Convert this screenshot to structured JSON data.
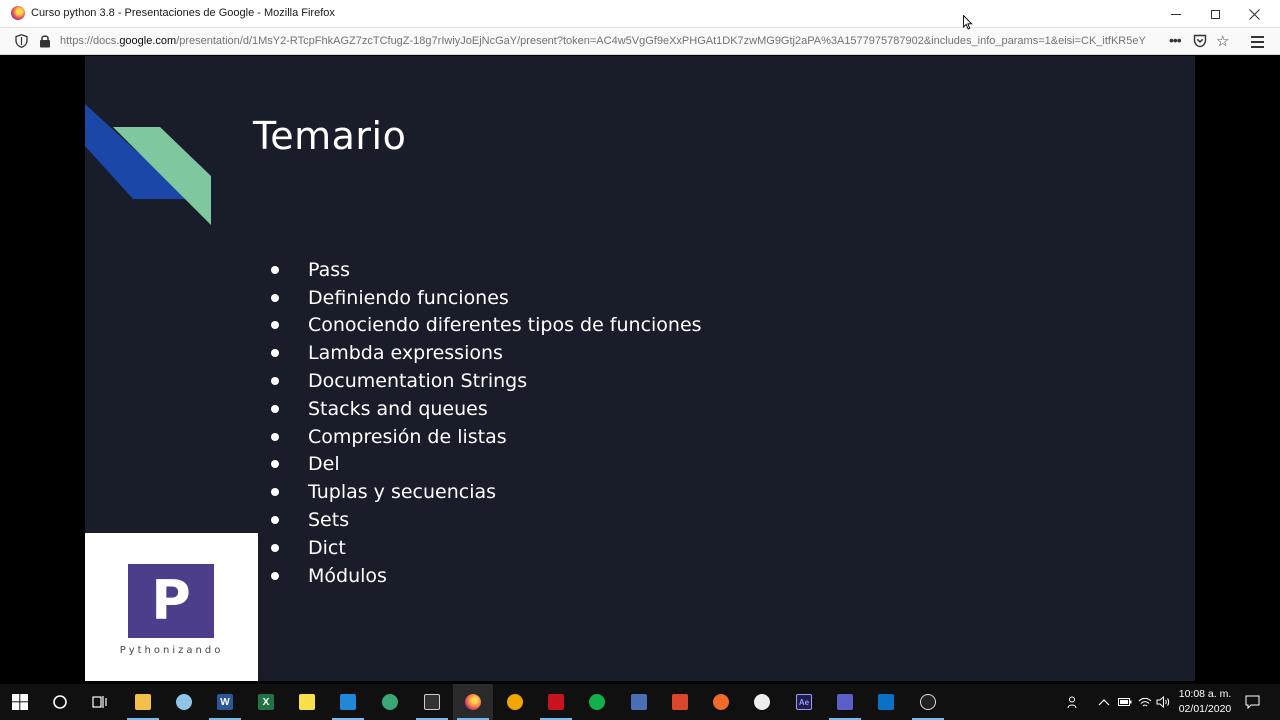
{
  "window": {
    "title": "Curso python 3.8 - Presentaciones de Google - Mozilla Firefox"
  },
  "navbar": {
    "url_prefix": "https://docs.",
    "url_domain": "google.com",
    "url_rest": "/presentation/d/1MsY2-RTcpFhkAGZ7zcTCfugZ-18g7rIwiyJoEjNcGaY/present?token=AC4w5VgGf9eXxPHGAt1DK7zwMG9Gtj2aPA%3A1577975787902&includes_info_params=1&eisi=CK_itfKR5eY",
    "more_label": "•••"
  },
  "slide": {
    "title": "Temario",
    "items": [
      "Pass",
      "Definiendo funciones",
      "Conociendo diferentes tipos de funciones",
      "Lambda expressions",
      "Documentation Strings",
      "Stacks and queues",
      "Compresión de listas",
      "Del",
      "Tuplas y secuencias",
      "Sets",
      "Dict",
      "Módulos"
    ],
    "logo_letter": "P",
    "logo_text": "Pythonizando",
    "colors": {
      "background": "#191c29",
      "stripe_blue": "#1a47a8",
      "stripe_green": "#7fc79f",
      "logo_purple": "#4d3d8a"
    }
  },
  "taskbar": {
    "time": "10:08 a. m.",
    "date": "02/01/2020",
    "apps": [
      "windows-start",
      "cortana",
      "task-view",
      "file-explorer",
      "paint",
      "word",
      "excel",
      "sticky-notes",
      "vscode",
      "app-green",
      "terminal",
      "firefox",
      "app-dark",
      "media",
      "app-green-2",
      "app-blue",
      "app-red",
      "app-orange",
      "app-dark-2",
      "after-effects",
      "teams",
      "outlook",
      "obs"
    ]
  }
}
